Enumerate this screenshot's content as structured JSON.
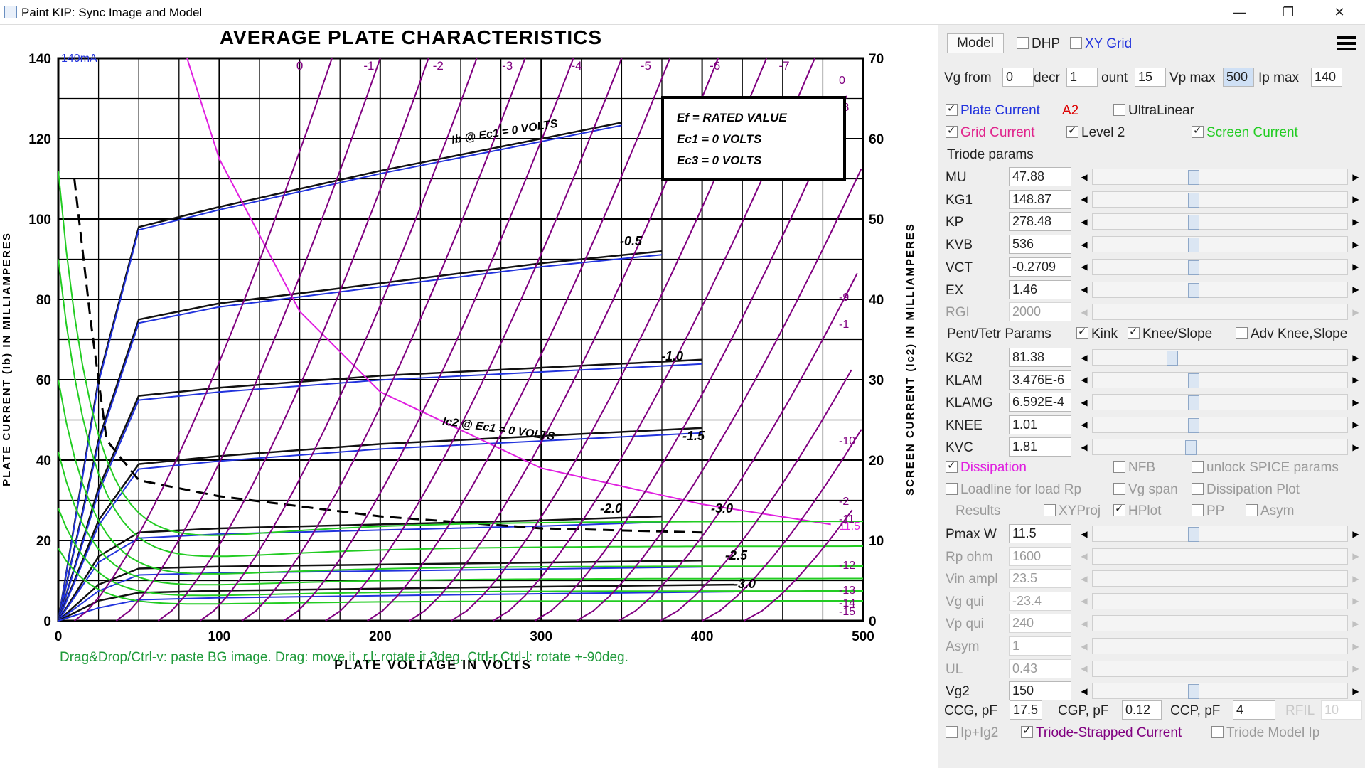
{
  "window": {
    "title": "Paint KIP: Sync Image and Model",
    "minimize": "—",
    "maximize": "❐",
    "close": "✕"
  },
  "chart": {
    "title": "AVERAGE PLATE CHARACTERISTICS",
    "xlabel": "PLATE VOLTAGE IN VOLTS",
    "ylabel_left": "PLATE CURRENT (Ib) IN MILLIAMPERES",
    "ylabel_right": "SCREEN CURRENT (Ic2) IN MILLIAMPERES",
    "x_ticks": [
      "0",
      "100",
      "200",
      "300",
      "400",
      "500"
    ],
    "y_left_ticks": [
      "0",
      "20",
      "40",
      "60",
      "80",
      "100",
      "120",
      "140"
    ],
    "y_right_ticks": [
      "0",
      "10",
      "20",
      "30",
      "40",
      "50",
      "60",
      "70"
    ],
    "ip_label": "140mA",
    "legend_lines": [
      "Ef = RATED VALUE",
      "Ec1 = 0 VOLTS",
      "Ec3 = 0 VOLTS"
    ],
    "anno_ib": "Ib @ Ec1 = 0 VOLTS",
    "anno_ic2": "Ic2 @ Ec1 = 0 VOLTS",
    "curve_labels": [
      "-0.5",
      "-1.0",
      "-1.5",
      "-2.0",
      "-2.5",
      "-3.0",
      "-1.0",
      "-3.0"
    ],
    "top_labels": [
      "0",
      "-1",
      "-2",
      "-3",
      "-4",
      "-5",
      "-6",
      "-7"
    ],
    "right_labels": [
      "0",
      "-8",
      "-9",
      "-1",
      "-10",
      "-2",
      "-11",
      "-12",
      "-13",
      "-14",
      "-15",
      "11.5"
    ],
    "hint": "Drag&Drop/Ctrl-v: paste BG image. Drag: move it, r,l: rotate it 3deg. Ctrl-r,Ctrl-l: rotate +-90deg."
  },
  "chart_data": {
    "type": "line",
    "title": "AVERAGE PLATE CHARACTERISTICS",
    "xlabel": "PLATE VOLTAGE IN VOLTS",
    "ylabel": "PLATE CURRENT (Ib) IN MILLIAMPERES",
    "ylabel_right": "SCREEN CURRENT (Ic2) IN MILLIAMPERES",
    "xlim": [
      0,
      500
    ],
    "ylim": [
      0,
      140
    ],
    "ylim_right": [
      0,
      70
    ],
    "grid": true,
    "series": [
      {
        "name": "",
        "x": [
          0,
          25,
          50,
          100,
          200,
          300,
          350
        ],
        "y": [
          0,
          60,
          98,
          103,
          112,
          120,
          124
        ]
      },
      {
        "name": "-0.5",
        "x": [
          0,
          25,
          50,
          100,
          200,
          300,
          375
        ],
        "y": [
          0,
          45,
          75,
          79,
          84,
          89,
          92
        ]
      },
      {
        "name": "-1.0",
        "x": [
          0,
          25,
          50,
          100,
          200,
          300,
          400
        ],
        "y": [
          0,
          33,
          56,
          58,
          61,
          63,
          65
        ]
      },
      {
        "name": "-1.5",
        "x": [
          0,
          25,
          50,
          100,
          200,
          300,
          400
        ],
        "y": [
          0,
          25,
          39,
          41,
          44,
          46,
          48
        ]
      },
      {
        "name": "-2.0",
        "x": [
          0,
          25,
          50,
          100,
          200,
          300,
          375
        ],
        "y": [
          0,
          16,
          22,
          23,
          24,
          25,
          26
        ]
      },
      {
        "name": "-2.5",
        "x": [
          0,
          25,
          50,
          100,
          200,
          300,
          400
        ],
        "y": [
          0,
          9,
          13,
          13.5,
          14,
          14.5,
          15
        ]
      },
      {
        "name": "-3.0",
        "x": [
          0,
          25,
          50,
          100,
          200,
          300,
          420
        ],
        "y": [
          0,
          5,
          7,
          7.5,
          8,
          8.5,
          9
        ]
      },
      {
        "name": "Ic2 @ Ec1 = 0 VOLTS",
        "x": [
          10,
          20,
          30,
          50,
          100,
          200,
          300,
          400
        ],
        "y": [
          110,
          75,
          45,
          35,
          31,
          26,
          23,
          22
        ]
      },
      {
        "name": "Dissipation",
        "x": [
          80,
          100,
          150,
          200,
          300,
          400,
          480
        ],
        "y": [
          140,
          115,
          77,
          57,
          38,
          29,
          24
        ]
      }
    ]
  },
  "panel": {
    "model_button": "Model",
    "dhp": "DHP",
    "xy_grid": "XY Grid",
    "vg_from_label": "Vg from",
    "vg_from": "0",
    "decr_label": "decr",
    "decr": "1",
    "count_label": "ount",
    "count": "15",
    "vpmax_label": "Vp max",
    "vpmax": "500",
    "ipmax_label": "Ip max",
    "ipmax": "140",
    "plate_current": "Plate Current",
    "a2": "A2",
    "ultralinear": "UltraLinear",
    "grid_current": "Grid Current",
    "level2": "Level 2",
    "screen_current": "Screen Current",
    "triode_params": "Triode params",
    "params": [
      {
        "name": "MU",
        "value": "47.88"
      },
      {
        "name": "KG1",
        "value": "148.87"
      },
      {
        "name": "KP",
        "value": "278.48"
      },
      {
        "name": "KVB",
        "value": "536"
      },
      {
        "name": "VCT",
        "value": "-0.2709"
      },
      {
        "name": "EX",
        "value": "1.46"
      },
      {
        "name": "RGI",
        "value": "2000"
      }
    ],
    "pent_params": "Pent/Tetr Params",
    "kink": "Kink",
    "knee_slope": "Knee/Slope",
    "adv_knee": "Adv Knee,Slope",
    "pparams": [
      {
        "name": "KG2",
        "value": "81.38"
      },
      {
        "name": "KLAM",
        "value": "3.476E-6"
      },
      {
        "name": "KLAMG",
        "value": "6.592E-4"
      },
      {
        "name": "KNEE",
        "value": "1.01"
      },
      {
        "name": "KVC",
        "value": "1.81"
      }
    ],
    "dissipation": "Dissipation",
    "nfb": "NFB",
    "unlock_spice": "unlock SPICE params",
    "loadline": "Loadline for load Rp",
    "vg_span": "Vg span",
    "dissipation_plot": "Dissipation Plot",
    "results": "Results",
    "xyproj": "XYProj",
    "hplot": "HPlot",
    "pp": "PP",
    "asym_chk": "Asym",
    "rparams": [
      {
        "name": "Pmax W",
        "value": "11.5"
      },
      {
        "name": "Rp ohm",
        "value": "1600"
      },
      {
        "name": "Vin ampl",
        "value": "23.5"
      },
      {
        "name": "Vg qui",
        "value": "-23.4"
      },
      {
        "name": "Vp qui",
        "value": "240"
      },
      {
        "name": "Asym",
        "value": "1"
      },
      {
        "name": "UL",
        "value": "0.43"
      },
      {
        "name": "Vg2",
        "value": "150"
      }
    ],
    "ccg_label": "CCG, pF",
    "ccg": "17.5",
    "cgp_label": "CGP, pF",
    "cgp": "0.12",
    "ccp_label": "CCP, pF",
    "ccp": "4",
    "rfil_label": "RFIL",
    "rfil": "10",
    "ip_ig2": "Ip+Ig2",
    "triode_strapped": "Triode-Strapped Current",
    "triode_model_ip": "Triode Model Ip"
  },
  "colors": {
    "plate_current": "#2233dd",
    "a2": "#dd0000",
    "grid_current": "#e0248c",
    "screen_current": "#22cc22",
    "dissipation": "#e020e0",
    "triode_strapped": "#800080",
    "hint": "#1f9a3a"
  }
}
